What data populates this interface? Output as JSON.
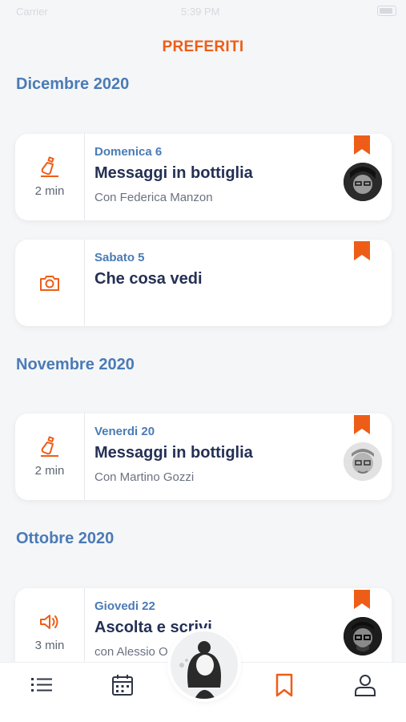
{
  "status_bar": {
    "carrier": "Carrier",
    "time": "5:39 PM"
  },
  "header": {
    "title": "PREFERITI"
  },
  "colors": {
    "accent": "#ee5d17",
    "section": "#4a7bb6",
    "title_text": "#243054"
  },
  "sections": [
    {
      "label": "Dicembre 2020"
    },
    {
      "label": "Novembre 2020"
    },
    {
      "label": "Ottobre 2020"
    }
  ],
  "cards": [
    {
      "icon": "bottle-icon",
      "duration": "2 min",
      "date": "Domenica 6",
      "title": "Messaggi in bottiglia",
      "with": "Con Federica Manzon",
      "bookmarked": true,
      "avatar": "avatar-federica"
    },
    {
      "icon": "camera-icon",
      "duration": "",
      "date": "Sabato 5",
      "title": "Che cosa vedi",
      "with": "",
      "bookmarked": true,
      "avatar": ""
    },
    {
      "icon": "bottle-icon",
      "duration": "2 min",
      "date": "Venerdi 20",
      "title": "Messaggi in bottiglia",
      "with": "Con Martino Gozzi",
      "bookmarked": true,
      "avatar": "avatar-martino"
    },
    {
      "icon": "speaker-icon",
      "duration": "3 min",
      "date": "Giovedi 22",
      "title": "Ascolta e scrivi",
      "with": "con Alessio O",
      "bookmarked": true,
      "avatar": "avatar-alessio"
    }
  ],
  "tabbar": {
    "items": [
      "list-icon",
      "calendar-icon",
      "center-avatar-button",
      "bookmark-icon",
      "profile-icon"
    ],
    "active": "bookmark-icon"
  }
}
